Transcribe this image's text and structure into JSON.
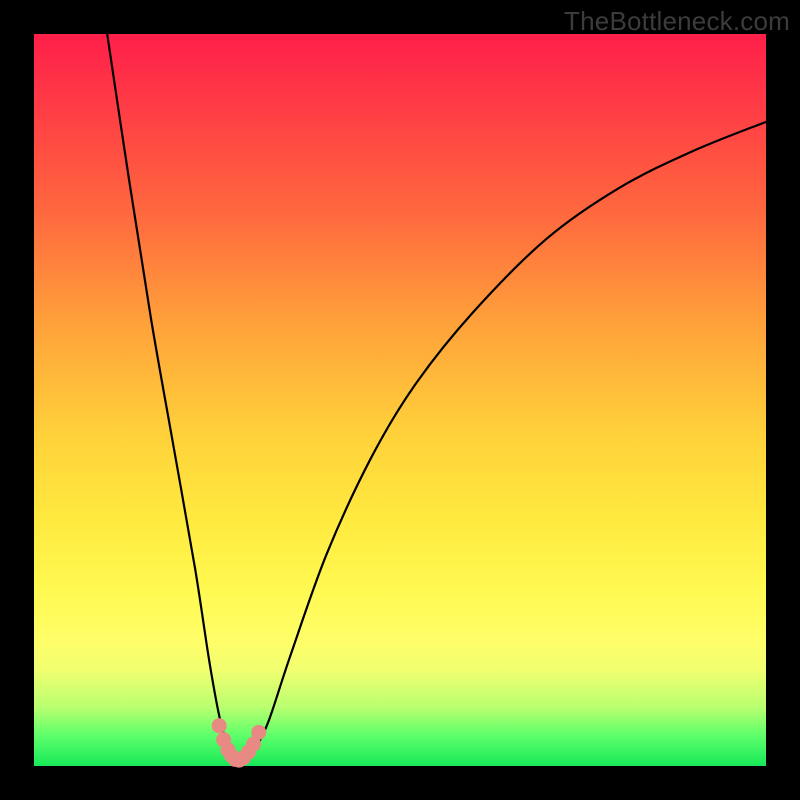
{
  "watermark": "TheBottleneck.com",
  "chart_data": {
    "type": "line",
    "title": "",
    "xlabel": "",
    "ylabel": "",
    "xlim": [
      0,
      100
    ],
    "ylim": [
      0,
      100
    ],
    "grid": false,
    "legend": false,
    "series": [
      {
        "name": "bottleneck-curve",
        "color": "#000000",
        "x": [
          10,
          13,
          16,
          19,
          22,
          24,
          25.5,
          27,
          28,
          29,
          30,
          32,
          35,
          40,
          46,
          52,
          60,
          70,
          80,
          90,
          100
        ],
        "y": [
          100,
          80,
          61,
          44,
          27,
          14,
          6,
          1.5,
          0.8,
          1.2,
          2,
          6,
          15,
          29,
          42,
          52,
          62,
          72,
          79,
          84,
          88
        ]
      },
      {
        "name": "minimum-markers",
        "color": "#e88a83",
        "type": "scatter",
        "x": [
          25.3,
          25.9,
          26.5,
          27,
          27.5,
          28,
          28.6,
          29.3,
          30,
          30.7
        ],
        "y": [
          5.5,
          3.6,
          2.2,
          1.4,
          0.9,
          0.8,
          1.1,
          1.9,
          3.0,
          4.6
        ]
      }
    ],
    "annotations": []
  },
  "colors": {
    "curve": "#000000",
    "markers": "#e88a83",
    "frame": "#000000"
  }
}
